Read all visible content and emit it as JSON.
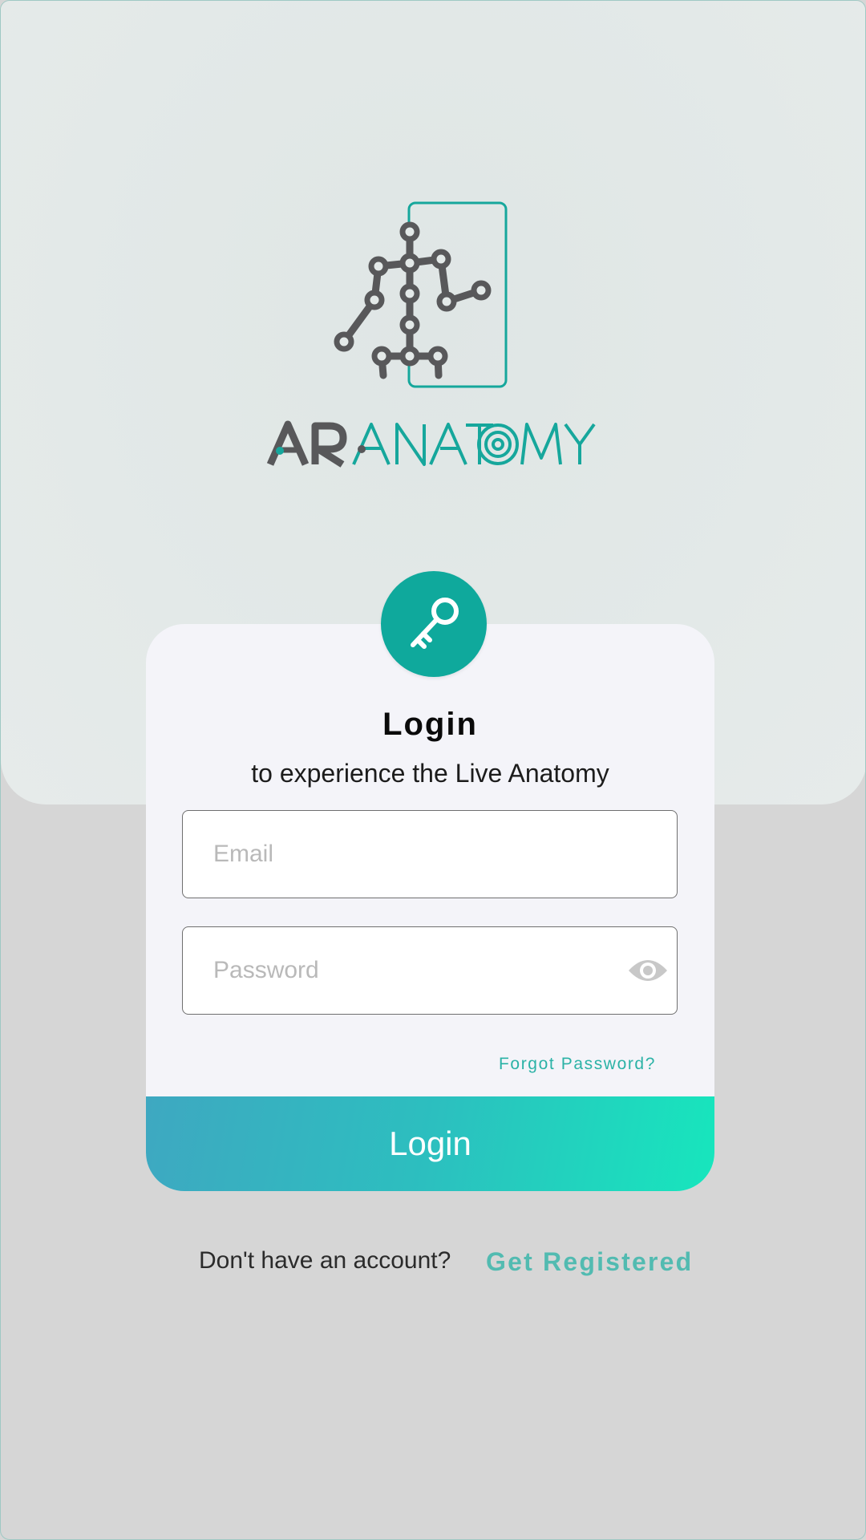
{
  "app": {
    "brand_lettering": "AR ANATOMY",
    "colors": {
      "accent": "#0fa99c",
      "brand_teal": "#16a79c",
      "brand_gray": "#58585a",
      "link": "#2bb2a6",
      "button_gradient_start": "#3ea8c1",
      "button_gradient_end": "#17e6bd"
    }
  },
  "login_card": {
    "badge_icon": "key-icon",
    "title": "Login",
    "subtitle": "to experience the Live Anatomy",
    "email": {
      "value": "",
      "placeholder": "Email"
    },
    "password": {
      "value": "",
      "placeholder": "Password",
      "toggle_icon": "eye-icon"
    },
    "forgot_password": "Forgot Password?",
    "login_button": "Login"
  },
  "register": {
    "prompt": "Don't have an account?",
    "link": "Get Registered"
  }
}
